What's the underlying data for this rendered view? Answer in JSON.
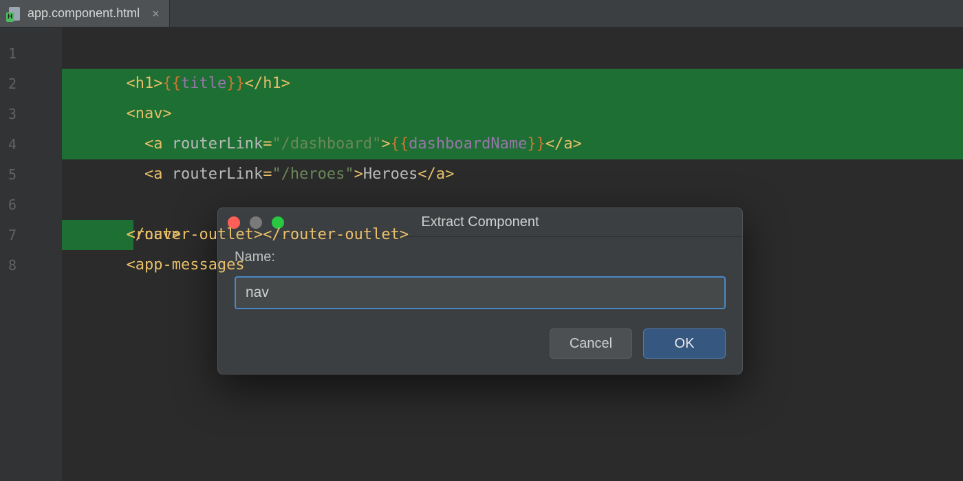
{
  "tab": {
    "filename": "app.component.html",
    "icon_badge": "H"
  },
  "gutter": {
    "line_numbers": [
      "1",
      "2",
      "3",
      "4",
      "5",
      "6",
      "7",
      "8"
    ]
  },
  "code": {
    "l1": {
      "open_h1": "<h1>",
      "dl_open": "{{",
      "ident": "title",
      "dl_close": "}}",
      "close_h1": "</h1>"
    },
    "l2": {
      "open_nav": "<nav>"
    },
    "l3": {
      "indent": "  ",
      "open_a": "<a ",
      "attr": "routerLink",
      "eq": "=",
      "val": "\"/dashboard\"",
      "gt": ">",
      "dl_open": "{{",
      "ident": "dashboardName",
      "dl_close": "}}",
      "close_a": "</a>"
    },
    "l4": {
      "indent": "  ",
      "open_a": "<a ",
      "attr": "routerLink",
      "eq": "=",
      "val": "\"/heroes\"",
      "gt": ">",
      "text": "Heroes",
      "close_a": "</a>"
    },
    "l5": {
      "close_nav": "</nav>"
    },
    "l6": {
      "open": "<router-outlet>",
      "close": "</router-outlet>"
    },
    "l7": {
      "open": "<app-messages"
    }
  },
  "dialog": {
    "title": "Extract Component",
    "name_label": "Name:",
    "name_value": "nav",
    "cancel": "Cancel",
    "ok": "OK"
  }
}
